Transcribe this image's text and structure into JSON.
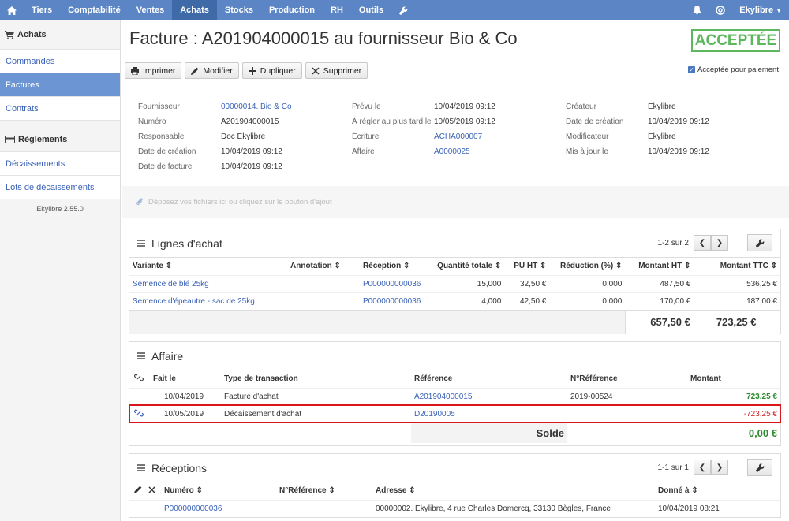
{
  "nav": {
    "items": [
      "Tiers",
      "Comptabilité",
      "Ventes",
      "Achats",
      "Stocks",
      "Production",
      "RH",
      "Outils"
    ],
    "active": "Achats",
    "user": "Ekylibre"
  },
  "sidebar": {
    "section1": "Achats",
    "items": [
      "Commandes",
      "Factures",
      "Contrats"
    ],
    "active": "Factures",
    "section2": "Règlements",
    "items2": [
      "Décaissements",
      "Lots de décaissements"
    ],
    "version": "Ekylibre 2.55.0"
  },
  "header": {
    "title": "Facture : A201904000015 au fournisseur Bio & Co",
    "status": "ACCEPTÉE"
  },
  "toolbar": {
    "print": "Imprimer",
    "edit": "Modifier",
    "duplicate": "Dupliquer",
    "delete": "Supprimer",
    "accepted_label": "Acceptée pour paiement"
  },
  "info": {
    "col1": [
      {
        "label": "Fournisseur",
        "value": "00000014. Bio & Co",
        "link": true
      },
      {
        "label": "Numéro",
        "value": "A201904000015"
      },
      {
        "label": "Responsable",
        "value": "Doc Ekylibre"
      },
      {
        "label": "Date de création",
        "value": "10/04/2019 09:12"
      },
      {
        "label": "Date de facture",
        "value": "10/04/2019 09:12"
      }
    ],
    "col2": [
      {
        "label": "Prévu le",
        "value": "10/04/2019 09:12"
      },
      {
        "label": "À régler au plus tard le",
        "value": "10/05/2019 09:12"
      },
      {
        "label": "Écriture",
        "value": "ACHA000007",
        "link": true
      },
      {
        "label": "Affaire",
        "value": "A0000025",
        "link": true
      }
    ],
    "col3": [
      {
        "label": "Créateur",
        "value": "Ekylibre"
      },
      {
        "label": "Date de création",
        "value": "10/04/2019 09:12"
      },
      {
        "label": "Modificateur",
        "value": "Ekylibre"
      },
      {
        "label": "Mis à jour le",
        "value": "10/04/2019 09:12"
      }
    ]
  },
  "dropzone": "Déposez vos fichiers ici ou cliquez sur le bouton d'ajout",
  "lines": {
    "title": "Lignes d'achat",
    "pager": "1-2 sur 2",
    "headers": [
      "Variante",
      "Annotation",
      "Réception",
      "Quantité totale",
      "PU HT",
      "Réduction (%)",
      "Montant HT",
      "Montant TTC"
    ],
    "rows": [
      [
        "Semence de blé 25kg",
        "",
        "P000000000036",
        "15,000",
        "32,50 €",
        "0,000",
        "487,50 €",
        "536,25 €"
      ],
      [
        "Semence d'épeautre - sac de 25kg",
        "",
        "P000000000036",
        "4,000",
        "42,50 €",
        "0,000",
        "170,00 €",
        "187,00 €"
      ]
    ],
    "total_ht": "657,50 €",
    "total_ttc": "723,25 €"
  },
  "affaire": {
    "title": "Affaire",
    "headers": [
      "Fait le",
      "Type de transaction",
      "Référence",
      "N°Référence",
      "Montant"
    ],
    "rows": [
      [
        "10/04/2019",
        "Facture d'achat",
        "A201904000015",
        "2019-00524",
        "723,25 €"
      ],
      [
        "10/05/2019",
        "Décaissement d'achat",
        "D20190005",
        "",
        "-723,25 €"
      ]
    ],
    "solde_label": "Solde",
    "solde": "0,00 €"
  },
  "receptions": {
    "title": "Réceptions",
    "pager": "1-1 sur 1",
    "headers": [
      "Numéro",
      "N°Référence",
      "Adresse",
      "Donné à"
    ],
    "rows": [
      [
        "P000000000036",
        "",
        "00000002. Ekylibre, 4 rue Charles Domercq, 33130 Bègles, France",
        "10/04/2019 08:21"
      ]
    ]
  }
}
